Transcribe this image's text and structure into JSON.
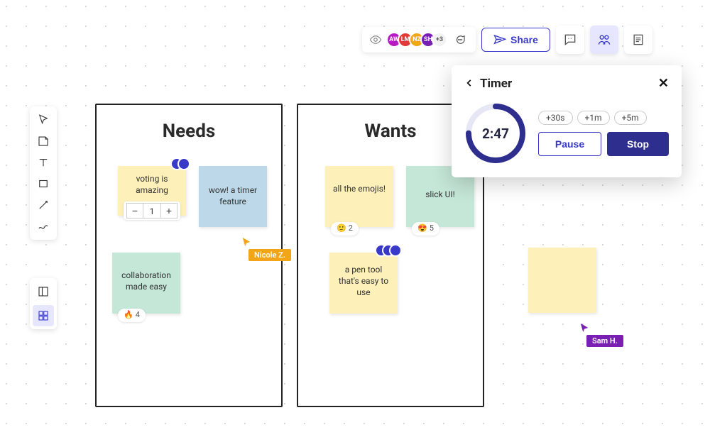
{
  "topbar": {
    "avatars": [
      {
        "initials": "AW",
        "color": "#b61bc2"
      },
      {
        "initials": "LM",
        "color": "#e03a3a"
      },
      {
        "initials": "NZ",
        "color": "#f2a516"
      },
      {
        "initials": "SH",
        "color": "#7a1fb3"
      }
    ],
    "more_count": "+3",
    "share_label": "Share"
  },
  "boards": {
    "needs": {
      "title": "Needs",
      "stickies": {
        "voting": {
          "text": "voting is amazing",
          "stepper_value": "1"
        },
        "timer": {
          "text": "wow! a timer feature"
        },
        "collab": {
          "text": "collaboration made easy",
          "reaction_emoji": "🔥",
          "reaction_count": "4"
        }
      }
    },
    "wants": {
      "title": "Wants",
      "stickies": {
        "emojis": {
          "text": "all the emojis!",
          "reaction_emoji": "🙂",
          "reaction_count": "2"
        },
        "slick": {
          "text": "slick UI!",
          "reaction_emoji": "😍",
          "reaction_count": "5"
        },
        "pen": {
          "text": "a pen tool that's easy to use"
        }
      }
    }
  },
  "cursors": {
    "nicole": {
      "name": "Nicole Z.",
      "color": "#f2a516"
    },
    "sam": {
      "name": "Sam H.",
      "color": "#7a1fb3"
    }
  },
  "timer": {
    "title": "Timer",
    "time": "2:47",
    "quick_adds": [
      "+30s",
      "+1m",
      "+5m"
    ],
    "pause_label": "Pause",
    "stop_label": "Stop",
    "progress_pct": 75
  }
}
